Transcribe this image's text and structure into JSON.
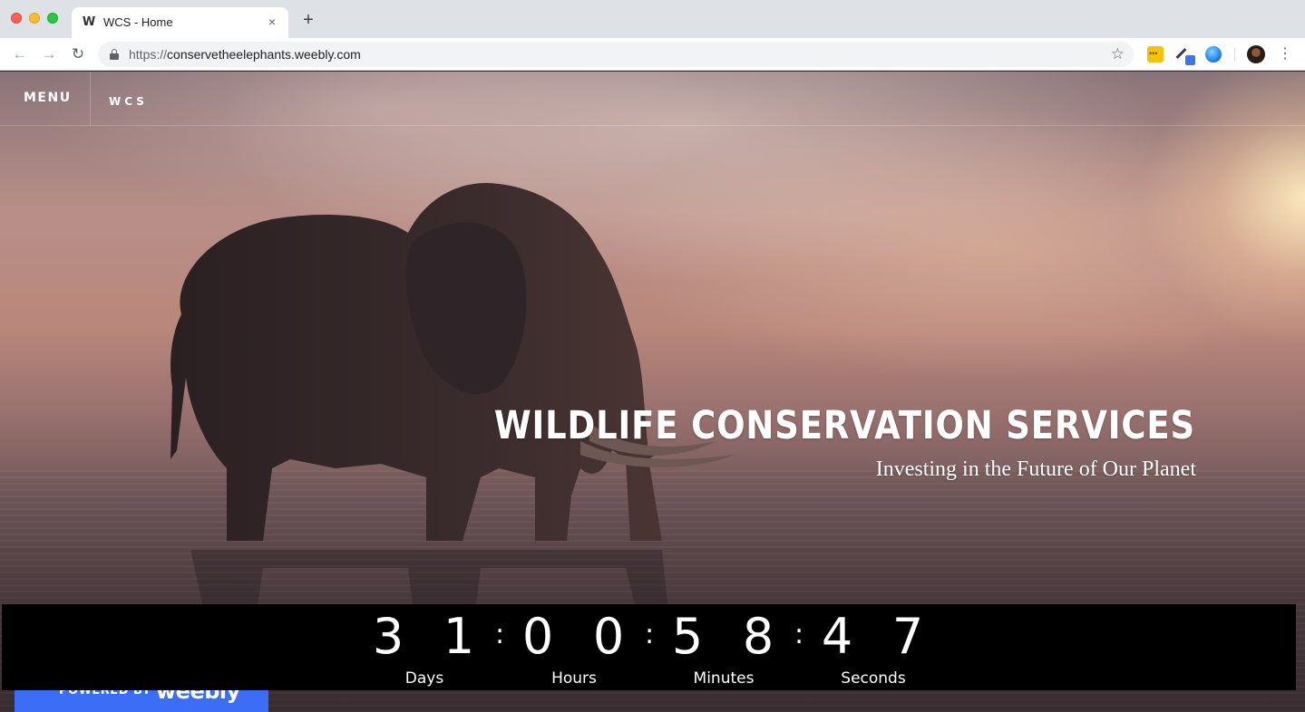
{
  "browser": {
    "tab_title": "WCS - Home",
    "tab_close": "×",
    "new_tab": "+",
    "favicon": "W",
    "url_scheme": "https://",
    "url_host": "conservetheelephants.weebly.com",
    "icons": [
      "back-arrow-icon",
      "forward-arrow-icon",
      "reload-icon",
      "lock-icon",
      "star-icon",
      "extension-icon",
      "eyedropper-icon",
      "globe-icon",
      "profile-avatar",
      "kebab-menu-icon"
    ]
  },
  "site": {
    "menu_label": "MENU",
    "title": "WCS",
    "hero_title": "WILDLIFE CONSERVATION SERVICES",
    "hero_subtitle": "Investing in the Future of Our Planet"
  },
  "countdown": {
    "digits": [
      "3",
      "1",
      "0",
      "0",
      "5",
      "8",
      "4",
      "7"
    ],
    "separator": ":",
    "labels": [
      "Days",
      "Hours",
      "Minutes",
      "Seconds"
    ]
  },
  "badge": {
    "powered_by": "POWERED BY",
    "brand": "weebly"
  },
  "colors": {
    "badge_blue": "#3b6df6",
    "countdown_bg": "#000000",
    "text": "#ffffff"
  }
}
